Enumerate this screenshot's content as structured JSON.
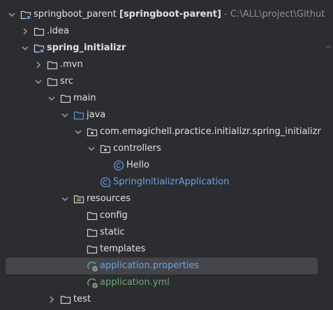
{
  "tree": {
    "root": {
      "name": "springboot_parent",
      "module": "[springboot-parent]",
      "path": "- C:\\ALL\\project\\GithubPro"
    },
    "idea": ".idea",
    "module": "spring_initializr",
    "mvn": ".mvn",
    "src": "src",
    "main": "main",
    "java": "java",
    "package": "com.emagichell.practice.initializr.spring_initializr",
    "controllers": "controllers",
    "hello": "Hello",
    "app_class": "SpringInitializrApplication",
    "resources": "resources",
    "config": "config",
    "static": "static",
    "templates": "templates",
    "app_properties": "application.properties",
    "app_yml": "application.yml",
    "test": "test"
  },
  "colors": {
    "background": "#2b2d30",
    "selection": "#43454a",
    "text": "#dfe1e5",
    "link_blue": "#6ea0e8",
    "config_green": "#6aab73",
    "muted": "#8c8f94"
  }
}
